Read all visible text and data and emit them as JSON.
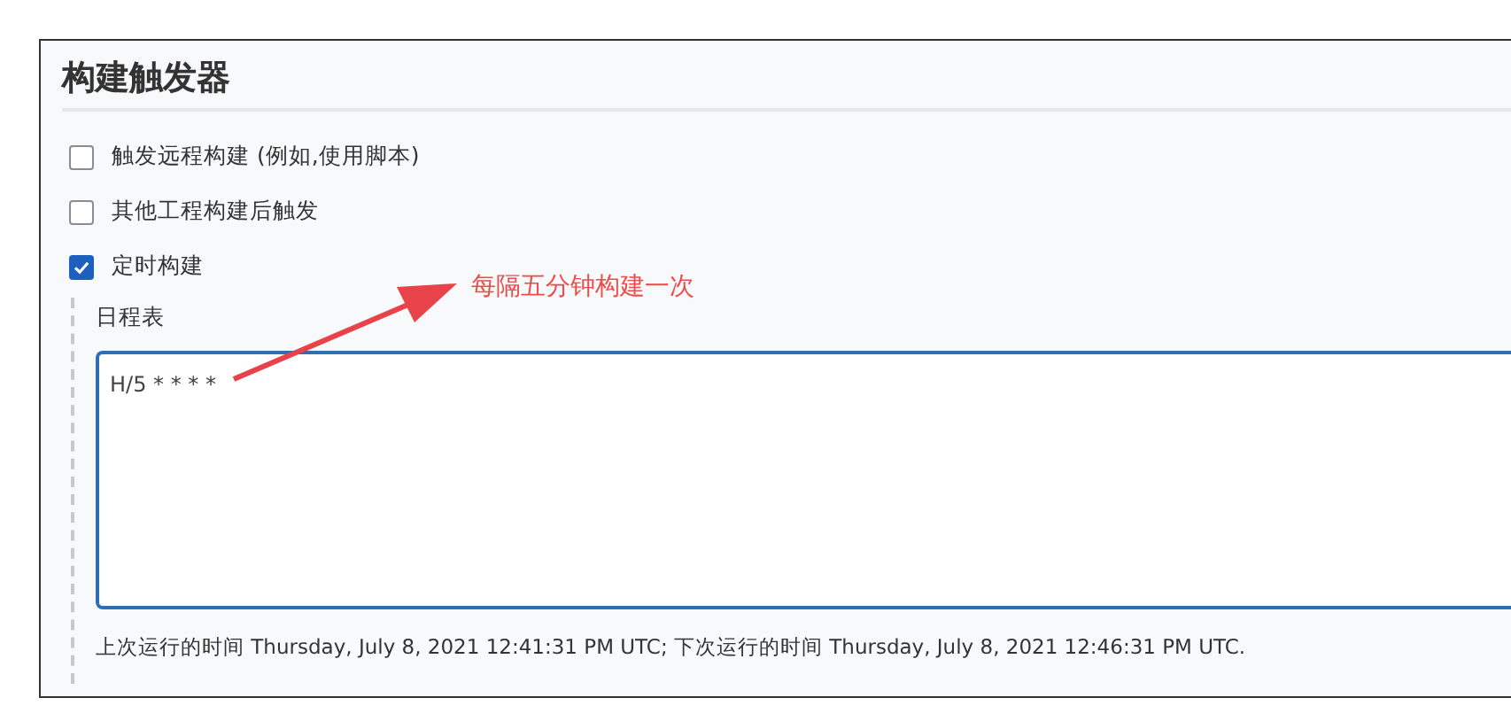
{
  "section": {
    "title": "构建触发器"
  },
  "triggers": [
    {
      "label": "触发远程构建 (例如,使用脚本)",
      "checked": false
    },
    {
      "label": "其他工程构建后触发",
      "checked": false
    },
    {
      "label": "定时构建",
      "checked": true
    }
  ],
  "schedule": {
    "label": "日程表",
    "value": "H/5 * * * *",
    "caption": "上次运行的时间 Thursday, July 8, 2021 12:41:31 PM UTC; 下次运行的时间 Thursday, July 8, 2021 12:46:31 PM UTC."
  },
  "annotation": {
    "text": "每隔五分钟构建一次"
  }
}
